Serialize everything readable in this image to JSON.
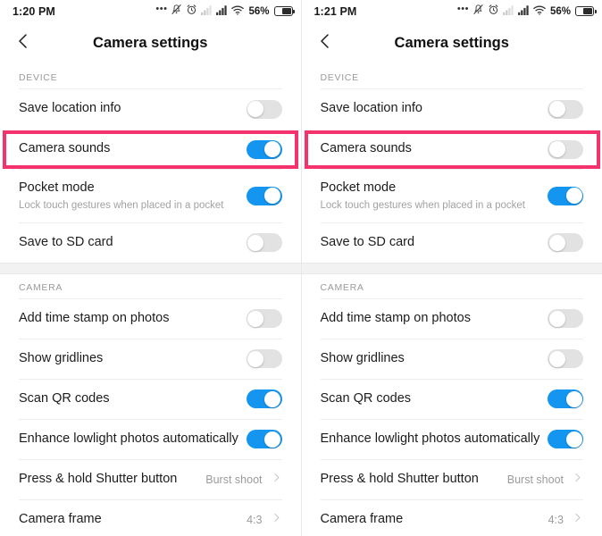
{
  "panels": [
    {
      "status": {
        "time": "1:20 PM",
        "battery_percent": "56%",
        "icons": [
          "more-dots-icon",
          "vibrate-off-icon",
          "alarm-icon",
          "signal-weak-icon",
          "signal-icon",
          "wifi-icon"
        ]
      },
      "header": {
        "title": "Camera settings",
        "back_icon": "back-chevron-icon"
      },
      "sections": [
        {
          "name": "DEVICE",
          "rows": [
            {
              "label": "Save location info",
              "sub": "",
              "control": "toggle",
              "state": "off",
              "highlighted": false
            },
            {
              "label": "Camera sounds",
              "sub": "",
              "control": "toggle",
              "state": "on",
              "highlighted": true
            },
            {
              "label": "Pocket mode",
              "sub": "Lock touch gestures when placed in a pocket",
              "control": "toggle",
              "state": "on",
              "highlighted": false
            },
            {
              "label": "Save to SD card",
              "sub": "",
              "control": "toggle",
              "state": "off",
              "highlighted": false
            }
          ]
        },
        {
          "name": "CAMERA",
          "rows": [
            {
              "label": "Add time stamp on photos",
              "sub": "",
              "control": "toggle",
              "state": "off",
              "highlighted": false
            },
            {
              "label": "Show gridlines",
              "sub": "",
              "control": "toggle",
              "state": "off",
              "highlighted": false
            },
            {
              "label": "Scan QR codes",
              "sub": "",
              "control": "toggle",
              "state": "on",
              "highlighted": false
            },
            {
              "label": "Enhance lowlight photos automatically",
              "sub": "",
              "control": "toggle",
              "state": "on",
              "highlighted": false
            },
            {
              "label": "Press & hold Shutter button",
              "sub": "",
              "control": "value",
              "value": "Burst shoot",
              "highlighted": false
            },
            {
              "label": "Camera frame",
              "sub": "",
              "control": "value",
              "value": "4:3",
              "highlighted": false
            }
          ]
        }
      ]
    },
    {
      "status": {
        "time": "1:21 PM",
        "battery_percent": "56%",
        "icons": [
          "more-dots-icon",
          "vibrate-off-icon",
          "alarm-icon",
          "signal-weak-icon",
          "signal-icon",
          "wifi-icon"
        ]
      },
      "header": {
        "title": "Camera settings",
        "back_icon": "back-chevron-icon"
      },
      "sections": [
        {
          "name": "DEVICE",
          "rows": [
            {
              "label": "Save location info",
              "sub": "",
              "control": "toggle",
              "state": "off",
              "highlighted": false
            },
            {
              "label": "Camera sounds",
              "sub": "",
              "control": "toggle",
              "state": "off",
              "highlighted": true
            },
            {
              "label": "Pocket mode",
              "sub": "Lock touch gestures when placed in a pocket",
              "control": "toggle",
              "state": "on",
              "highlighted": false
            },
            {
              "label": "Save to SD card",
              "sub": "",
              "control": "toggle",
              "state": "off",
              "highlighted": false
            }
          ]
        },
        {
          "name": "CAMERA",
          "rows": [
            {
              "label": "Add time stamp on photos",
              "sub": "",
              "control": "toggle",
              "state": "off",
              "highlighted": false
            },
            {
              "label": "Show gridlines",
              "sub": "",
              "control": "toggle",
              "state": "off",
              "highlighted": false
            },
            {
              "label": "Scan QR codes",
              "sub": "",
              "control": "toggle",
              "state": "on",
              "highlighted": false
            },
            {
              "label": "Enhance lowlight photos automatically",
              "sub": "",
              "control": "toggle",
              "state": "on",
              "highlighted": false
            },
            {
              "label": "Press & hold Shutter button",
              "sub": "",
              "control": "value",
              "value": "Burst shoot",
              "highlighted": false
            },
            {
              "label": "Camera frame",
              "sub": "",
              "control": "value",
              "value": "4:3",
              "highlighted": false
            }
          ]
        }
      ]
    }
  ],
  "colors": {
    "toggle_on": "#1495f0",
    "toggle_off": "#e2e2e2",
    "highlight": "#f4326b"
  }
}
